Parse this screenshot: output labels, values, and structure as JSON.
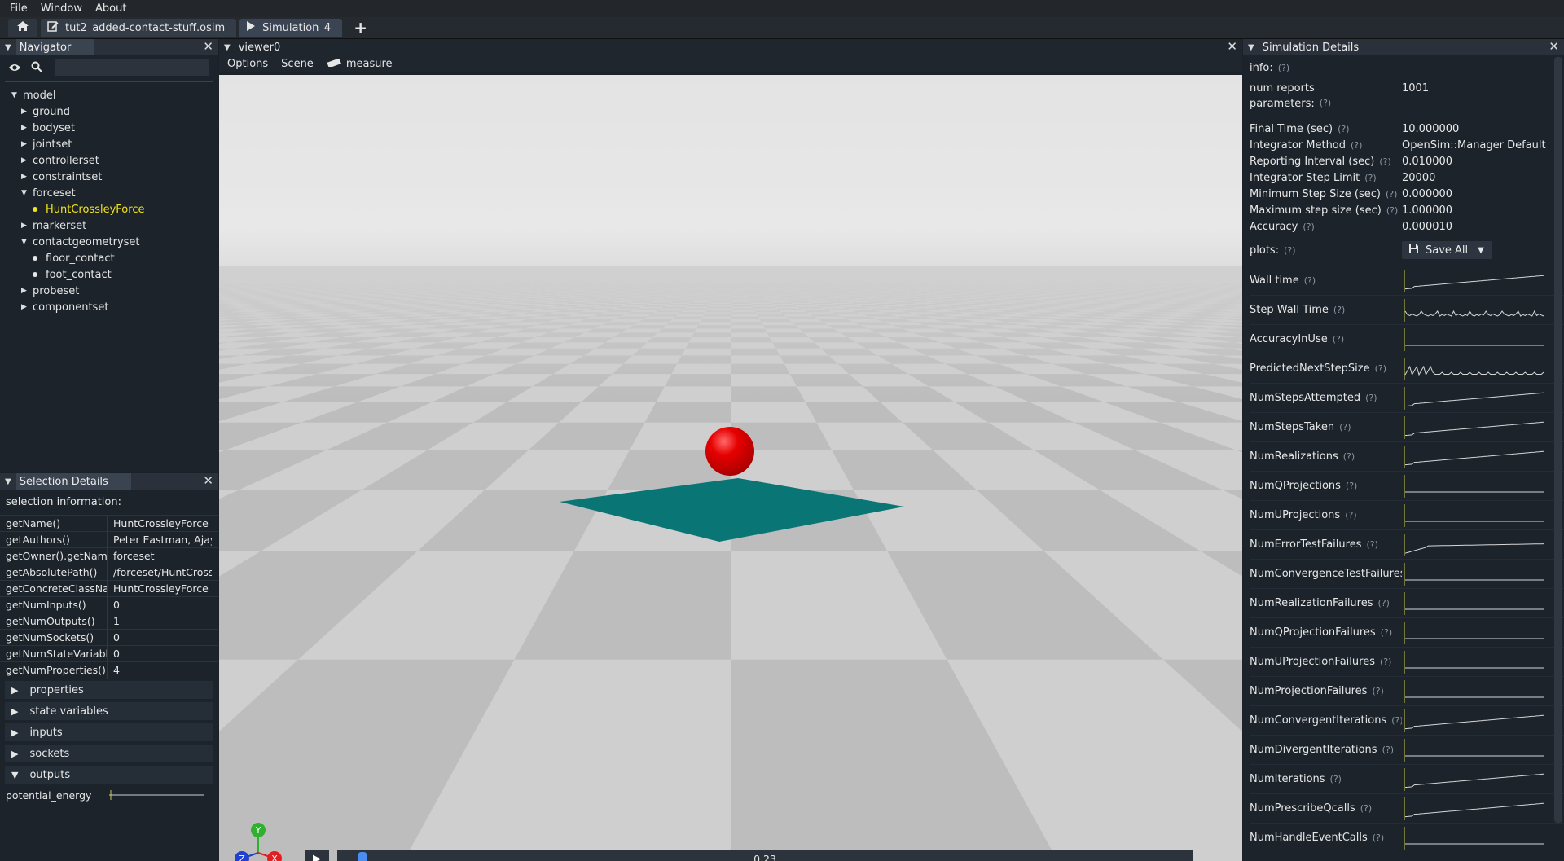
{
  "menu": [
    "File",
    "Window",
    "About"
  ],
  "tabs": {
    "file_tab": "tut2_added-contact-stuff.osim",
    "sim_tab": "Simulation_4",
    "add_label": "+"
  },
  "navigator": {
    "title": "Navigator",
    "search_value": "",
    "tree": [
      {
        "label": "model",
        "kind": "open",
        "level": 0
      },
      {
        "label": "ground",
        "kind": "closed",
        "level": 1
      },
      {
        "label": "bodyset",
        "kind": "closed",
        "level": 1
      },
      {
        "label": "jointset",
        "kind": "closed",
        "level": 1
      },
      {
        "label": "controllerset",
        "kind": "closed",
        "level": 1
      },
      {
        "label": "constraintset",
        "kind": "closed",
        "level": 1
      },
      {
        "label": "forceset",
        "kind": "open",
        "level": 1
      },
      {
        "label": "HuntCrossleyForce",
        "kind": "leaf",
        "level": 2,
        "selected": true
      },
      {
        "label": "markerset",
        "kind": "closed",
        "level": 1
      },
      {
        "label": "contactgeometryset",
        "kind": "open",
        "level": 1
      },
      {
        "label": "floor_contact",
        "kind": "leaf",
        "level": 2
      },
      {
        "label": "foot_contact",
        "kind": "leaf",
        "level": 2
      },
      {
        "label": "probeset",
        "kind": "closed",
        "level": 1
      },
      {
        "label": "componentset",
        "kind": "closed",
        "level": 1
      }
    ]
  },
  "selection": {
    "title": "Selection Details",
    "info_label": "selection information:",
    "rows": [
      {
        "k": "getName()",
        "v": "HuntCrossleyForce"
      },
      {
        "k": "getAuthors()",
        "v": "Peter Eastman, Ajay"
      },
      {
        "k": "getOwner().getName()",
        "v": "forceset"
      },
      {
        "k": "getAbsolutePath()",
        "v": "/forceset/HuntCrossleyForce"
      },
      {
        "k": "getConcreteClassName()",
        "v": "HuntCrossleyForce"
      },
      {
        "k": "getNumInputs()",
        "v": "0"
      },
      {
        "k": "getNumOutputs()",
        "v": "1"
      },
      {
        "k": "getNumSockets()",
        "v": "0"
      },
      {
        "k": "getNumStateVariables()",
        "v": "0"
      },
      {
        "k": "getNumProperties()",
        "v": "4"
      }
    ],
    "sections": [
      {
        "label": "properties",
        "open": false
      },
      {
        "label": "state variables",
        "open": false
      },
      {
        "label": "inputs",
        "open": false
      },
      {
        "label": "sockets",
        "open": false
      },
      {
        "label": "outputs",
        "open": true
      }
    ],
    "output_name": "potential_energy"
  },
  "viewer": {
    "title": "viewer0",
    "menu": [
      "Options",
      "Scene"
    ],
    "measure_label": "measure",
    "time_value": "0.23",
    "time_fraction": 0.023,
    "axis_labels": {
      "x": "X",
      "y": "Y",
      "z": "Z"
    }
  },
  "sim": {
    "title": "Simulation Details",
    "info_label": "info:",
    "help_mark": "(?)",
    "num_reports_label": "num reports",
    "num_reports": "1001",
    "parameters_label": "parameters:",
    "params": [
      {
        "k": "Final Time (sec)",
        "v": "10.000000"
      },
      {
        "k": "Integrator Method",
        "v": "OpenSim::Manager Default"
      },
      {
        "k": "Reporting Interval (sec)",
        "v": "0.010000"
      },
      {
        "k": "Integrator Step Limit",
        "v": "20000"
      },
      {
        "k": "Minimum Step Size (sec)",
        "v": "0.000000"
      },
      {
        "k": "Maximum step size (sec)",
        "v": "1.000000"
      },
      {
        "k": "Accuracy",
        "v": "0.000010"
      }
    ],
    "plots_label": "plots:",
    "save_all_label": "Save All",
    "plots": [
      {
        "name": "Wall time",
        "shape": "rise"
      },
      {
        "name": "Step Wall Time",
        "shape": "noise"
      },
      {
        "name": "AccuracyInUse",
        "shape": "flat"
      },
      {
        "name": "PredictedNextStepSize",
        "shape": "spiky"
      },
      {
        "name": "NumStepsAttempted",
        "shape": "rise"
      },
      {
        "name": "NumStepsTaken",
        "shape": "rise"
      },
      {
        "name": "NumRealizations",
        "shape": "rise"
      },
      {
        "name": "NumQProjections",
        "shape": "flat"
      },
      {
        "name": "NumUProjections",
        "shape": "flat"
      },
      {
        "name": "NumErrorTestFailures",
        "shape": "step"
      },
      {
        "name": "NumConvergenceTestFailures",
        "shape": "flat"
      },
      {
        "name": "NumRealizationFailures",
        "shape": "flat"
      },
      {
        "name": "NumQProjectionFailures",
        "shape": "flat"
      },
      {
        "name": "NumUProjectionFailures",
        "shape": "flat"
      },
      {
        "name": "NumProjectionFailures",
        "shape": "flat"
      },
      {
        "name": "NumConvergentIterations",
        "shape": "rise"
      },
      {
        "name": "NumDivergentIterations",
        "shape": "flat"
      },
      {
        "name": "NumIterations",
        "shape": "rise"
      },
      {
        "name": "NumPrescribeQcalls",
        "shape": "rise"
      },
      {
        "name": "NumHandleEventCalls",
        "shape": "flat"
      }
    ]
  },
  "colors": {
    "selected_tree_item": "#f2e31c",
    "ball": "#e60000",
    "platform": "#0a7575",
    "slider_thumb": "#4a8ef0",
    "plot_marker": "#c8c84a"
  }
}
